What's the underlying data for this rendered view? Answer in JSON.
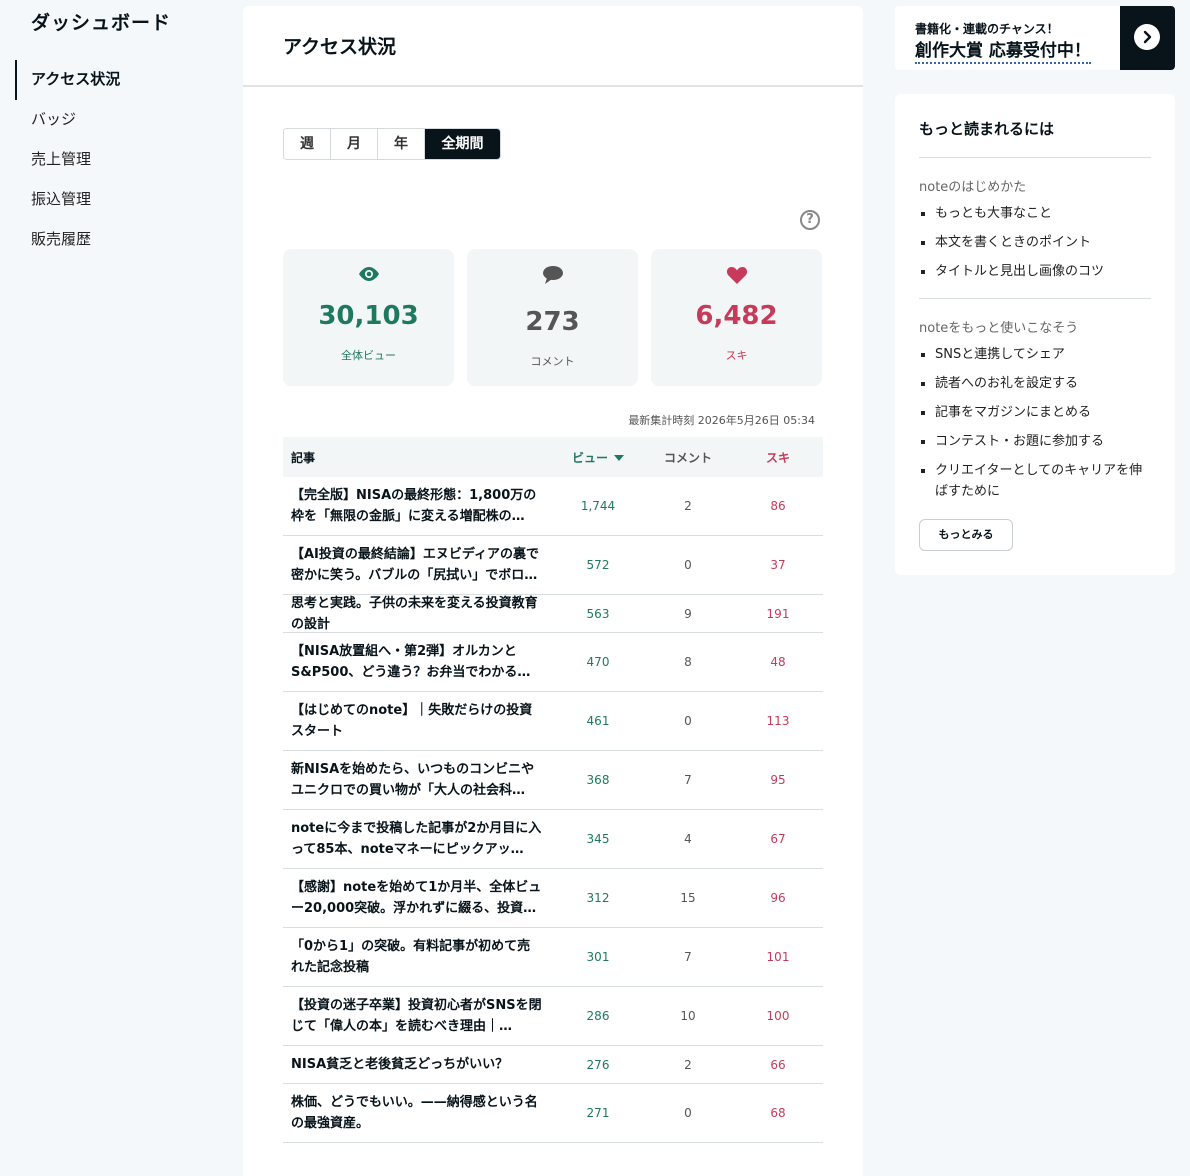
{
  "sidebar": {
    "title": "ダッシュボード",
    "items": [
      {
        "label": "アクセス状況",
        "active": true
      },
      {
        "label": "バッジ"
      },
      {
        "label": "売上管理"
      },
      {
        "label": "振込管理"
      },
      {
        "label": "販売履歴"
      }
    ]
  },
  "main": {
    "title": "アクセス状況",
    "tabs": [
      {
        "label": "週"
      },
      {
        "label": "月"
      },
      {
        "label": "年"
      },
      {
        "label": "全期間",
        "active": true
      }
    ],
    "help_icon": "question-circle-icon",
    "stats": {
      "views": {
        "value": "30,103",
        "label": "全体ビュー",
        "icon": "eye-icon",
        "color": "#1f7a5c"
      },
      "comments": {
        "value": "273",
        "label": "コメント",
        "icon": "speech-bubble-icon",
        "color": "#555555"
      },
      "likes": {
        "value": "6,482",
        "label": "スキ",
        "icon": "heart-icon",
        "color": "#c73a5a"
      }
    },
    "updated": "最新集計時刻 2026年5月26日 05:34",
    "table": {
      "headers": {
        "title": "記事",
        "views": "ビュー",
        "comments": "コメント",
        "likes": "スキ"
      },
      "rows": [
        {
          "title": "【完全版】NISAの最終形態：1,800万の枠を「無限の金脈」に変える増配株の…",
          "views": "1,744",
          "comments": "2",
          "likes": "86"
        },
        {
          "title": "【AI投資の最終結論】エヌビディアの裏で密かに笑う。バブルの「尻拭い」でボロ…",
          "views": "572",
          "comments": "0",
          "likes": "37"
        },
        {
          "title": "思考と実践。子供の未来を変える投資教育の設計",
          "views": "563",
          "comments": "9",
          "likes": "191"
        },
        {
          "title": "【NISA放置組へ・第2弾】オルカンとS&P500、どう違う？お弁当でわかる「自分…",
          "views": "470",
          "comments": "8",
          "likes": "48"
        },
        {
          "title": "【はじめてのnote】｜失敗だらけの投資スタート",
          "views": "461",
          "comments": "0",
          "likes": "113"
        },
        {
          "title": "新NISAを始めたら、いつものコンビニやユニクロでの買い物が「大人の社会科…",
          "views": "368",
          "comments": "7",
          "likes": "95"
        },
        {
          "title": "noteに今まで投稿した記事が2か月目に入って85本、noteマネーにピックアッ…",
          "views": "345",
          "comments": "4",
          "likes": "67"
        },
        {
          "title": "【感謝】noteを始めて1か月半、全体ビュー20,000突破。浮かれずに綴る、投資…",
          "views": "312",
          "comments": "15",
          "likes": "96"
        },
        {
          "title": "「0から1」の突破。有料記事が初めて売れた記念投稿",
          "views": "301",
          "comments": "7",
          "likes": "101"
        },
        {
          "title": "【投資の迷子卒業】投資初心者がSNSを閉じて「偉人の本」を読むべき理由｜…",
          "views": "286",
          "comments": "10",
          "likes": "100"
        },
        {
          "title": "NISA貧乏と老後貧乏どっちがいい？",
          "views": "276",
          "comments": "2",
          "likes": "66"
        },
        {
          "title": "株価、どうでもいい。——納得感という名の最強資産。",
          "views": "271",
          "comments": "0",
          "likes": "68"
        }
      ]
    }
  },
  "banner": {
    "line1": "書籍化・連載のチャンス！",
    "line2": "創作大賞 応募受付中！",
    "icon": "chevron-right-icon"
  },
  "tips": {
    "title": "もっと読まれるには",
    "sections": [
      {
        "heading": "noteのはじめかた",
        "items": [
          "もっとも大事なこと",
          "本文を書くときのポイント",
          "タイトルと見出し画像のコツ"
        ]
      },
      {
        "heading": "noteをもっと使いこなそう",
        "items": [
          "SNSと連携してシェア",
          "読者へのお礼を設定する",
          "記事をマガジンにまとめる",
          "コンテスト・お題に参加する",
          "クリエイターとしてのキャリアを伸ばすために"
        ]
      }
    ],
    "more_label": "もっとみる"
  }
}
